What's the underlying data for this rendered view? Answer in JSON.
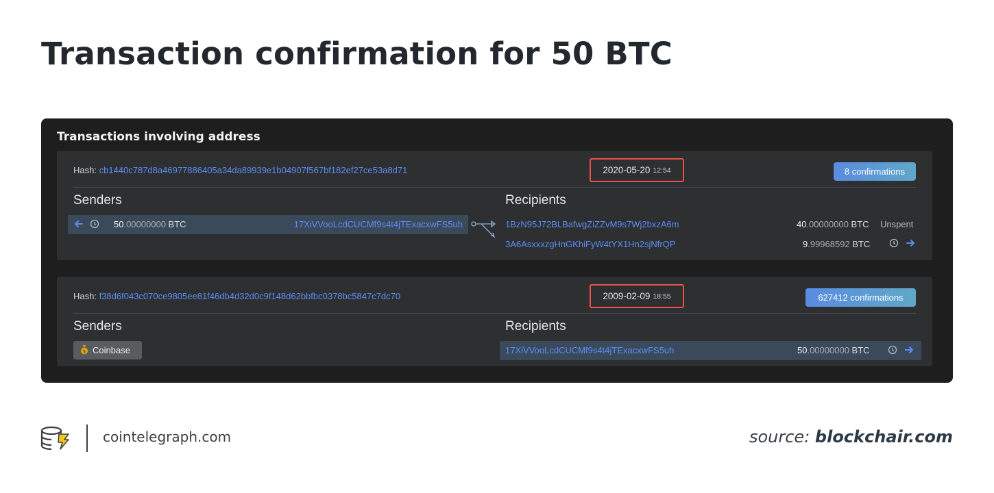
{
  "title": "Transaction confirmation for 50 BTC",
  "panel": {
    "title": "Transactions involving address"
  },
  "transactions": [
    {
      "hash_label": "Hash:",
      "hash": "cb1440c787d8a46977886405a34da89939e1b04907f567bf182ef27ce53a8d71",
      "date": "2020-05-20",
      "time": "12:54",
      "confirmations": "8 confirmations",
      "senders_label": "Senders",
      "recipients_label": "Recipients",
      "sender": {
        "amount_int": "50",
        "amount_dec": ".00000000",
        "unit": "BTC",
        "address": "17XiVVooLcdCUCMf9s4t4jTExacxwFS5uh"
      },
      "recipients": [
        {
          "address": "1BzN95J72BLBafwgZiZZvM9s7Wj2bxzA6m",
          "amount_int": "40",
          "amount_dec": ".00000000",
          "unit": "BTC",
          "status": "Unspent"
        },
        {
          "address": "3A6AsxxxzgHnGKhiFyW4tYX1Hn2sjNfrQP",
          "amount_int": "9",
          "amount_dec": ".99968592",
          "unit": "BTC"
        }
      ]
    },
    {
      "hash_label": "Hash:",
      "hash": "f38d6f043c070ce9805ee81f46db4d32d0c9f148d62bbfbc0378bc5847c7dc70",
      "date": "2009-02-09",
      "time": "18:55",
      "confirmations": "627412 confirmations",
      "senders_label": "Senders",
      "recipients_label": "Recipients",
      "coinbase_label": "Coinbase",
      "recipient": {
        "address": "17XiVVooLcdCUCMf9s4t4jTExacxwFS5uh",
        "amount_int": "50",
        "amount_dec": ".00000000",
        "unit": "BTC"
      }
    }
  ],
  "footer": {
    "site": "cointelegraph.com",
    "source_label": "source:",
    "source_brand": "blockchair.com"
  },
  "colors": {
    "link": "#5b8df6",
    "highlight_border": "#e8524a",
    "panel_bg": "#1e1e1e",
    "card_bg": "#2e2f31",
    "row_highlight": "#3b4a5a"
  },
  "icons": [
    "arrow-left-icon",
    "clock-icon",
    "flow-split-icon",
    "arrow-right-icon",
    "money-bag-icon",
    "cointelegraph-logo-icon"
  ]
}
